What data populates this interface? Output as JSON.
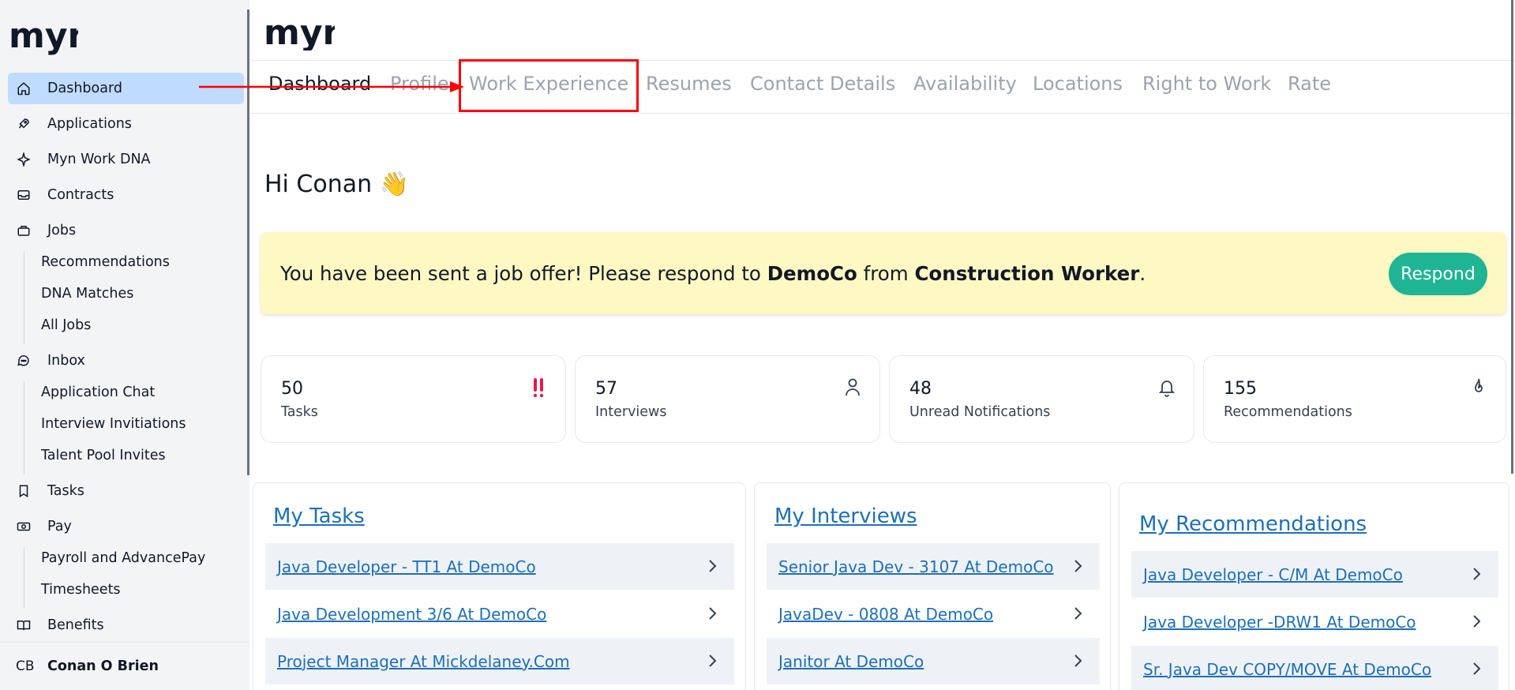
{
  "brand": {
    "logo_text": "myn"
  },
  "sidebar": {
    "items": [
      {
        "label": "Dashboard",
        "icon": "home-icon"
      },
      {
        "label": "Applications",
        "icon": "rocket-icon"
      },
      {
        "label": "Myn Work DNA",
        "icon": "sparkle-icon"
      },
      {
        "label": "Contracts",
        "icon": "inbox-tray-icon"
      },
      {
        "label": "Jobs",
        "icon": "briefcase-icon"
      },
      {
        "label": "Inbox",
        "icon": "chat-bubble-icon"
      },
      {
        "label": "Tasks",
        "icon": "bookmark-icon"
      },
      {
        "label": "Pay",
        "icon": "cash-icon"
      },
      {
        "label": "Benefits",
        "icon": "book-open-icon"
      }
    ],
    "jobs_sub": [
      "Recommendations",
      "DNA Matches",
      "All Jobs"
    ],
    "inbox_sub": [
      "Application Chat",
      "Interview Invitiations",
      "Talent Pool Invites"
    ],
    "pay_sub": [
      "Payroll and AdvancePay",
      "Timesheets"
    ],
    "user": {
      "initials": "CB",
      "name": "Conan O Brien"
    }
  },
  "tabs": [
    "Dashboard",
    "Profile",
    "Work Experience",
    "Resumes",
    "Contact Details",
    "Availability",
    "Locations",
    "Right to Work",
    "Rate"
  ],
  "greeting": "Hi Conan 👋",
  "offer": {
    "prefix": "You have been sent a job offer! Please respond to ",
    "company": "DemoCo",
    "middle": " from ",
    "role": "Construction Worker",
    "suffix": ".",
    "button": "Respond"
  },
  "stats": [
    {
      "value": "50",
      "label": "Tasks",
      "icon": "double-exclamation-icon"
    },
    {
      "value": "57",
      "label": "Interviews",
      "icon": "user-icon"
    },
    {
      "value": "48",
      "label": "Unread Notifications",
      "icon": "bell-icon"
    },
    {
      "value": "155",
      "label": "Recommendations",
      "icon": "flame-icon"
    }
  ],
  "cards": {
    "tasks": {
      "title": "My Tasks",
      "rows": [
        "Java Developer - TT1 At DemoCo",
        "Java Development 3/6 At DemoCo",
        "Project Manager At Mickdelaney.Com"
      ]
    },
    "interviews": {
      "title": "My Interviews",
      "rows": [
        "Senior Java Dev - 3107 At DemoCo",
        "JavaDev - 0808 At DemoCo",
        "Janitor At DemoCo"
      ]
    },
    "recommendations": {
      "title": "My Recommendations",
      "rows": [
        "Java Developer - C/M At DemoCo",
        "Java Developer -DRW1 At DemoCo",
        "Sr. Java Dev COPY/MOVE At DemoCo"
      ]
    }
  },
  "colors": {
    "accent": "#1fb594",
    "link": "#1d6fb8",
    "active_nav": "#bfdbfe",
    "offer_bg": "#fef9c3",
    "annotation": "#ff0000",
    "alert": "#e11d48"
  }
}
